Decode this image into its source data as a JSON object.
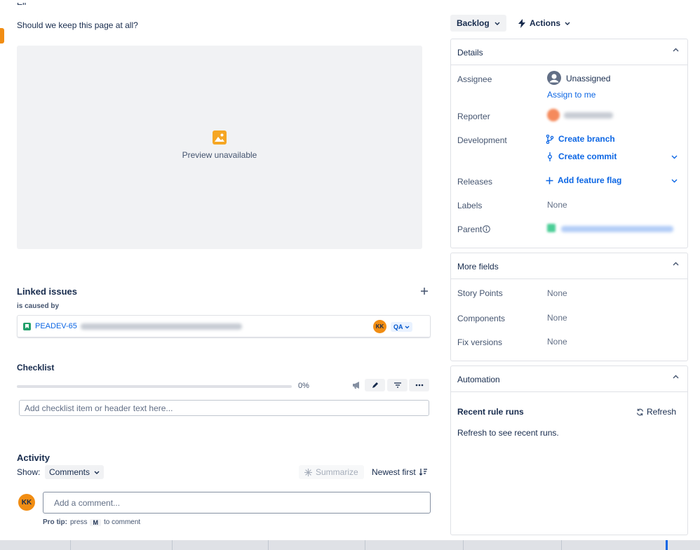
{
  "main": {
    "description_question": "Should we keep this page at all?",
    "preview_caption": "Preview unavailable",
    "linked": {
      "title": "Linked issues",
      "relation": "is caused by",
      "issue_key": "PEADEV-65",
      "assignee_initials": "KK",
      "status": "QA"
    },
    "checklist": {
      "title": "Checklist",
      "progress": 0,
      "progress_label": "0%",
      "input_placeholder": "Add checklist item or header text here..."
    },
    "activity": {
      "title": "Activity",
      "show_label": "Show:",
      "filter": "Comments",
      "summarize": "Summarize",
      "sort": "Newest first",
      "user_initials": "KK",
      "comment_placeholder": "Add a comment...",
      "pro_tip_label": "Pro tip:",
      "pro_tip_press": "press",
      "pro_tip_key": "M",
      "pro_tip_suffix": "to comment"
    }
  },
  "side": {
    "status_button": "Backlog",
    "actions_button": "Actions",
    "details": {
      "title": "Details",
      "assignee_label": "Assignee",
      "assignee_value": "Unassigned",
      "assign_to_me": "Assign to me",
      "reporter_label": "Reporter",
      "development_label": "Development",
      "create_branch": "Create branch",
      "create_commit": "Create commit",
      "releases_label": "Releases",
      "add_feature_flag": "Add feature flag",
      "labels_label": "Labels",
      "labels_value": "None",
      "parent_label": "Parent"
    },
    "more_fields": {
      "title": "More fields",
      "story_points_label": "Story Points",
      "story_points_value": "None",
      "components_label": "Components",
      "components_value": "None",
      "fix_versions_label": "Fix versions",
      "fix_versions_value": "None"
    },
    "automation": {
      "title": "Automation",
      "recent_rule_runs": "Recent rule runs",
      "refresh": "Refresh",
      "empty_text": "Refresh to see recent runs."
    }
  },
  "colors": {
    "link": "#0c66e4",
    "avatar": "#f18d13",
    "story": "#22a06b"
  }
}
